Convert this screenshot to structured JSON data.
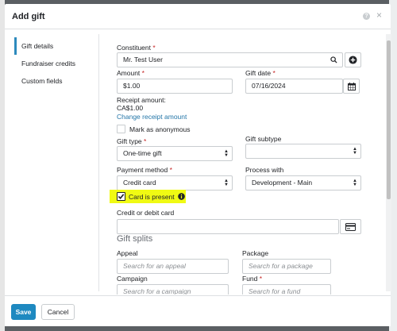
{
  "modal": {
    "title": "Add gift"
  },
  "tabs": [
    {
      "label": "Gift details"
    },
    {
      "label": "Fundraiser credits"
    },
    {
      "label": "Custom fields"
    }
  ],
  "form": {
    "constituent": {
      "label": "Constituent",
      "required": "*",
      "value": "Mr. Test User"
    },
    "amount": {
      "label": "Amount",
      "required": "*",
      "value": "$1.00"
    },
    "gift_date": {
      "label": "Gift date",
      "required": "*",
      "value": "07/16/2024"
    },
    "receipt_amount": {
      "label": "Receipt amount:",
      "value": "CA$1.00",
      "change_link": "Change receipt amount"
    },
    "anonymous": {
      "label": "Mark as anonymous"
    },
    "gift_type": {
      "label": "Gift type",
      "required": "*",
      "value": "One-time gift"
    },
    "gift_subtype": {
      "label": "Gift subtype",
      "value": ""
    },
    "payment_method": {
      "label": "Payment method",
      "required": "*",
      "value": "Credit card"
    },
    "process_with": {
      "label": "Process with",
      "value": "Development - Main"
    },
    "card_present": {
      "label": "Card is present"
    },
    "card": {
      "label": "Credit or debit card",
      "value": ""
    },
    "gift_splits": {
      "title": "Gift splits"
    },
    "appeal": {
      "label": "Appeal",
      "placeholder": "Search for an appeal"
    },
    "package": {
      "label": "Package",
      "placeholder": "Search for a package"
    },
    "campaign": {
      "label": "Campaign",
      "placeholder": "Search for a campaign"
    },
    "fund": {
      "label": "Fund",
      "required": "*",
      "placeholder": "Search for a fund"
    }
  },
  "footer": {
    "save": "Save",
    "cancel": "Cancel"
  },
  "colors": {
    "primary": "#1e89c0",
    "link": "#2476a8",
    "required": "#c52525",
    "highlight": "#f0fa13"
  },
  "icons": [
    "help-icon",
    "close-icon",
    "search-icon",
    "plus-circle-icon",
    "calendar-icon",
    "checkmark-icon",
    "info-icon",
    "credit-card-icon"
  ]
}
